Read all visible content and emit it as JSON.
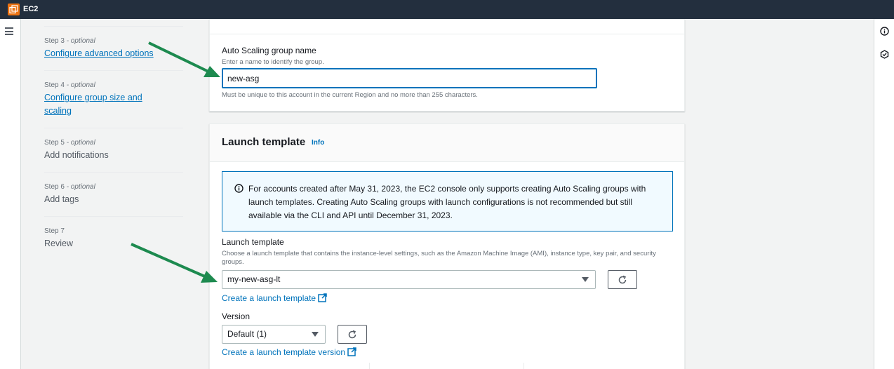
{
  "topbar": {
    "service_name": "EC2"
  },
  "wizard": {
    "steps": [
      {
        "num": "Step 3",
        "opt": " - optional",
        "title": "Configure advanced options",
        "link": true
      },
      {
        "num": "Step 4",
        "opt": " - optional",
        "title": "Configure group size and scaling",
        "link": true
      },
      {
        "num": "Step 5",
        "opt": " - optional",
        "title": "Add notifications",
        "link": false
      },
      {
        "num": "Step 6",
        "opt": " - optional",
        "title": "Add tags",
        "link": false
      },
      {
        "num": "Step 7",
        "opt": "",
        "title": "Review",
        "link": false
      }
    ]
  },
  "name_section": {
    "label": "Auto Scaling group name",
    "description": "Enter a name to identify the group.",
    "value": "new-asg",
    "constraint": "Must be unique to this account in the current Region and no more than 255 characters."
  },
  "launch_template": {
    "header": "Launch template",
    "info": "Info",
    "alert": "For accounts created after May 31, 2023, the EC2 console only supports creating Auto Scaling groups with launch templates. Creating Auto Scaling groups with launch configurations is not recommended but still available via the CLI and API until December 31, 2023.",
    "field_label": "Launch template",
    "field_description": "Choose a launch template that contains the instance-level settings, such as the Amazon Machine Image (AMI), instance type, key pair, and security groups.",
    "selected": "my-new-asg-lt",
    "create_link": "Create a launch template",
    "version_label": "Version",
    "version_selected": "Default (1)",
    "create_version_link": "Create a launch template version"
  },
  "colors": {
    "topbar": "#232f3e",
    "accent": "#0073bb",
    "brand": "#ec7211",
    "arrow": "#1d8a4f"
  }
}
